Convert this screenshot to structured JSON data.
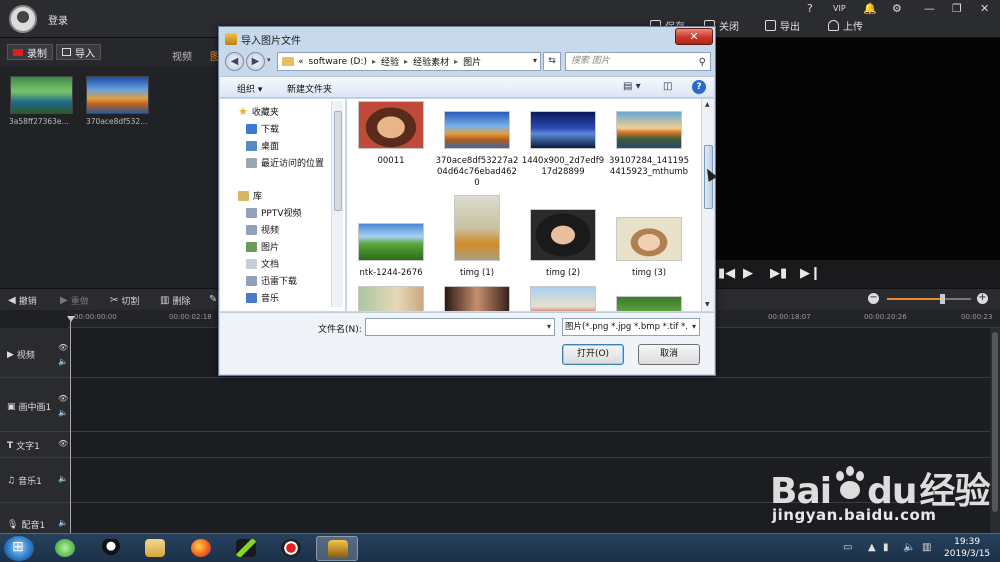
{
  "app": {
    "login_label": "登录",
    "toolbar": {
      "save": "保存",
      "close": "关闭",
      "export": "导出",
      "upload": "上传"
    },
    "window_controls": {
      "help": "?",
      "vip": "VIP"
    },
    "record": "录制",
    "import": "导入",
    "media_tabs": {
      "video": "视频",
      "image": "图"
    },
    "media_items": [
      {
        "name": "3a58ff27363e…"
      },
      {
        "name": "370ace8df532…"
      }
    ]
  },
  "edit_toolbar": {
    "undo": "撤销",
    "redo": "重做",
    "cut": "切割",
    "delete": "删除"
  },
  "timeline": {
    "ticks": [
      "00:00:00:00",
      "00:00:02:18",
      "00:00:18:07",
      "00:00:20:26",
      "00:00:23"
    ],
    "tracks": [
      {
        "label": "视频"
      },
      {
        "label": "画中画1"
      },
      {
        "label": "文字1"
      },
      {
        "label": "音乐1"
      },
      {
        "label": "配音1"
      }
    ],
    "zoom_level": 0.65
  },
  "dialog": {
    "title": "导入图片文件",
    "close": "✕",
    "address": {
      "prefix": "«",
      "segments": [
        "software (D:)",
        "经验",
        "经验素材",
        "图片"
      ]
    },
    "search_placeholder": "搜索 图片",
    "commands": {
      "organize": "组织 ▾",
      "new_folder": "新建文件夹"
    },
    "nav": {
      "favorites": "收藏夹",
      "downloads": "下载",
      "desktop": "桌面",
      "recent": "最近访问的位置",
      "libraries": "库",
      "pptv": "PPTV视频",
      "videos": "视频",
      "pictures": "图片",
      "documents": "文档",
      "thunder": "迅雷下载",
      "music": "音乐"
    },
    "files": [
      {
        "name": "00011"
      },
      {
        "name": "370ace8df53227a204d64c76ebad4620"
      },
      {
        "name": "1440x900_2d7edf917d28899"
      },
      {
        "name": "39107284_1411954415923_mthumb"
      },
      {
        "name": "ntk-1244-2676"
      },
      {
        "name": "timg (1)"
      },
      {
        "name": "timg (2)"
      },
      {
        "name": "timg (3)"
      }
    ],
    "filename_label": "文件名(N):",
    "filename_value": "",
    "filetype": "图片(*.png *.jpg *.bmp *.tif *.",
    "open_button": "打开(O)",
    "cancel_button": "取消"
  },
  "watermark": {
    "logo": "Bai",
    "logo2": "du",
    "logo3": "经验",
    "url": "jingyan.baidu.com"
  },
  "taskbar": {
    "time": "19:39",
    "date": "2019/3/15"
  }
}
